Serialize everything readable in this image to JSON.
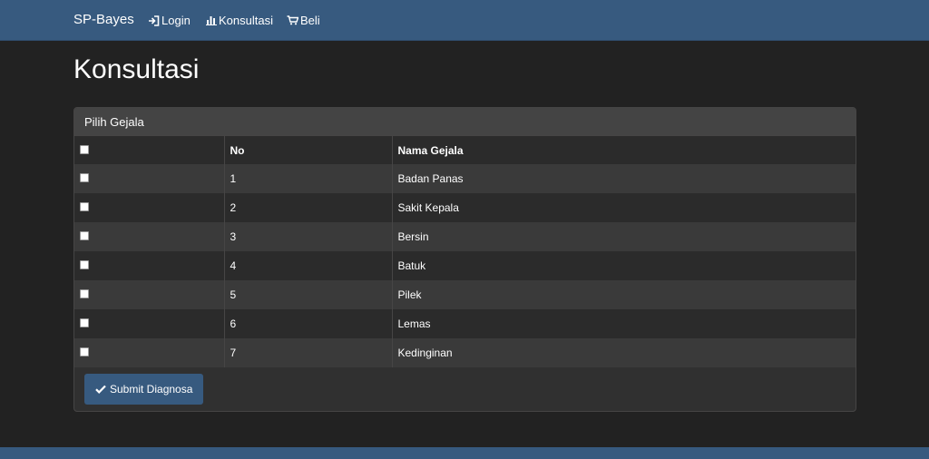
{
  "navbar": {
    "brand": "SP-Bayes",
    "items": [
      {
        "label": "Login",
        "icon": "login-icon"
      },
      {
        "label": "Konsultasi",
        "icon": "bar-chart-icon"
      },
      {
        "label": "Beli",
        "icon": "cart-icon"
      }
    ]
  },
  "page": {
    "title": "Konsultasi"
  },
  "panel": {
    "heading": "Pilih Gejala",
    "columns": {
      "no": "No",
      "name": "Nama Gejala"
    },
    "rows": [
      {
        "no": "1",
        "name": "Badan Panas"
      },
      {
        "no": "2",
        "name": "Sakit Kepala"
      },
      {
        "no": "3",
        "name": "Bersin"
      },
      {
        "no": "4",
        "name": "Batuk"
      },
      {
        "no": "5",
        "name": "Pilek"
      },
      {
        "no": "6",
        "name": "Lemas"
      },
      {
        "no": "7",
        "name": "Kedinginan"
      }
    ],
    "submit_label": "Submit Diagnosa"
  },
  "colors": {
    "navbar": "#375a7f",
    "background": "#222222",
    "panel": "#303030"
  }
}
